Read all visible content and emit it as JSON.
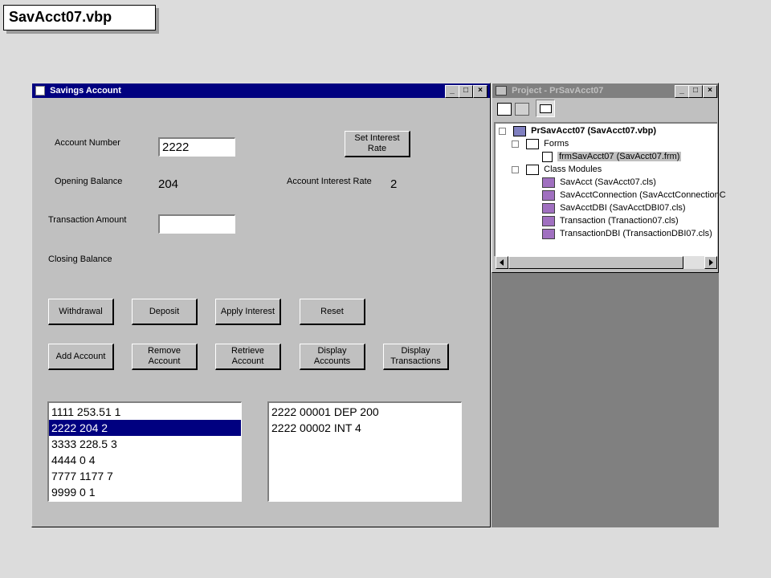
{
  "slide": {
    "title": "SavAcct07.vbp"
  },
  "form": {
    "title": "Savings Account",
    "labels": {
      "account_number": "Account Number",
      "opening_balance": "Opening Balance",
      "interest_rate": "Account Interest Rate",
      "transaction_amount": "Transaction Amount",
      "closing_balance": "Closing Balance"
    },
    "values": {
      "account_number": "2222",
      "opening_balance": "204",
      "interest_rate": "2",
      "transaction_amount": ""
    },
    "buttons": {
      "set_interest_line1": "Set Interest",
      "set_interest_line2": "Rate",
      "withdrawal": "Withdrawal",
      "deposit": "Deposit",
      "apply_interest": "Apply Interest",
      "reset": "Reset",
      "add_account": "Add Account",
      "remove_l1": "Remove",
      "remove_l2": "Account",
      "retrieve_l1": "Retrieve",
      "retrieve_l2": "Account",
      "display_accounts_l1": "Display",
      "display_accounts_l2": "Accounts",
      "display_trans_l1": "Display",
      "display_trans_l2": "Transactions"
    },
    "accounts_list": [
      "1111 253.51 1",
      "2222 204 2",
      "3333 228.5 3",
      "4444 0 4",
      "7777 1177 7",
      "9999 0 1"
    ],
    "accounts_selected_index": 1,
    "transactions_list": [
      "2222 00001 DEP 200",
      "2222 00002 INT 4"
    ]
  },
  "project": {
    "title": "Project - PrSavAcct07",
    "root": "PrSavAcct07 (SavAcct07.vbp)",
    "forms_folder": "Forms",
    "form_item": "frmSavAcct07 (SavAcct07.frm)",
    "class_folder": "Class Modules",
    "classes": [
      "SavAcct (SavAcct07.cls)",
      "SavAcctConnection (SavAcctConnectionC",
      "SavAcctDBI (SavAcctDBI07.cls)",
      "Transaction (Tranaction07.cls)",
      "TransactionDBI (TransactionDBI07.cls)"
    ]
  },
  "window_buttons": {
    "minimize": "_",
    "maximize": "□",
    "close": "×"
  },
  "colors": {
    "titlebar_active": "#000080",
    "titlebar_inactive": "#808080",
    "selection": "#000080"
  }
}
